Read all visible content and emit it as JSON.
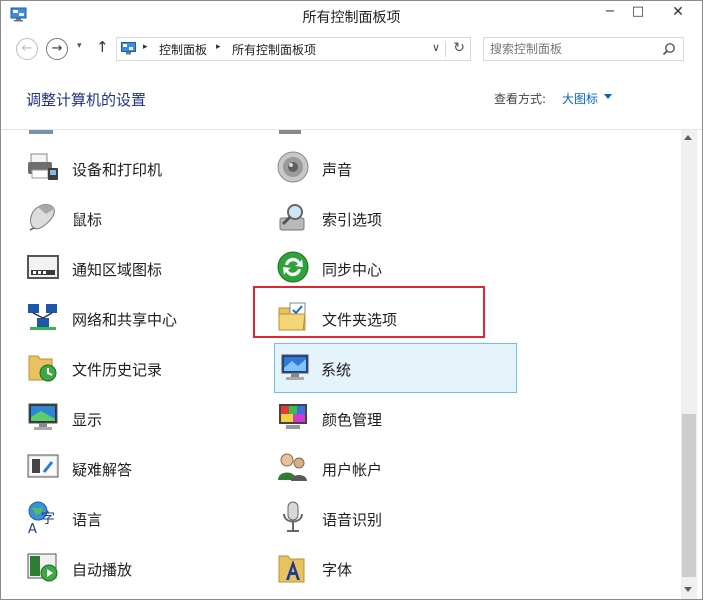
{
  "window": {
    "title": "所有控制面板项",
    "min_glyph": "−",
    "max_glyph": "□",
    "close_glyph": "✕"
  },
  "nav": {
    "back_glyph": "←",
    "forward_glyph": "→",
    "history_glyph": "▾",
    "up_glyph": "↑",
    "breadcrumb": [
      "控制面板",
      "所有控制面板项"
    ],
    "crumb_sep": "▸",
    "addr_drop_glyph": "∨",
    "refresh_glyph": "↻"
  },
  "search": {
    "placeholder": "搜索控制面板",
    "value": ""
  },
  "header": {
    "title": "调整计算机的设置",
    "view_label": "查看方式:",
    "view_value": "大图标"
  },
  "items": {
    "devices_printers": "设备和打印机",
    "sound": "声音",
    "mouse": "鼠标",
    "indexing": "索引选项",
    "notification_icons": "通知区域图标",
    "sync_center": "同步中心",
    "network_sharing": "网络和共享中心",
    "folder_options": "文件夹选项",
    "file_history": "文件历史记录",
    "system": "系统",
    "display": "显示",
    "color_management": "颜色管理",
    "troubleshooting": "疑难解答",
    "user_accounts": "用户帐户",
    "language": "语言",
    "speech_recognition": "语音识别",
    "autoplay": "自动播放",
    "fonts": "字体"
  },
  "colors": {
    "link_blue": "#0066cc",
    "title_blue": "#1e3287",
    "selected_bg": "#e5f3fb",
    "selected_border": "#70c0e7",
    "highlight_red": "#e0262e"
  }
}
